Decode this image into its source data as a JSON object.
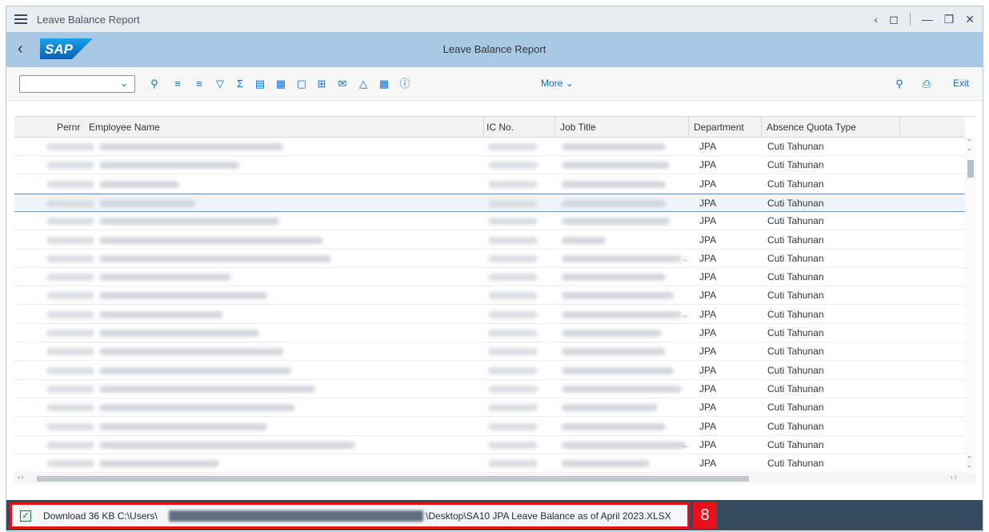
{
  "window": {
    "title": "Leave Balance Report"
  },
  "shell": {
    "title": "Leave Balance Report"
  },
  "toolbar": {
    "more_label": "More",
    "exit_label": "Exit"
  },
  "table": {
    "columns": [
      "Pernr",
      "Employee Name",
      "IC No.",
      "Job Title",
      "Department",
      "Absence Quota Type"
    ],
    "rows": [
      {
        "department": "JPA",
        "quota": "Cuti Tahunan"
      },
      {
        "department": "JPA",
        "quota": "Cuti Tahunan"
      },
      {
        "department": "JPA",
        "quota": "Cuti Tahunan"
      },
      {
        "department": "JPA",
        "quota": "Cuti Tahunan"
      },
      {
        "department": "JPA",
        "quota": "Cuti Tahunan"
      },
      {
        "department": "JPA",
        "quota": "Cuti Tahunan"
      },
      {
        "department": "JPA",
        "quota": "Cuti Tahunan"
      },
      {
        "department": "JPA",
        "quota": "Cuti Tahunan"
      },
      {
        "department": "JPA",
        "quota": "Cuti Tahunan"
      },
      {
        "department": "JPA",
        "quota": "Cuti Tahunan"
      },
      {
        "department": "JPA",
        "quota": "Cuti Tahunan"
      },
      {
        "department": "JPA",
        "quota": "Cuti Tahunan"
      },
      {
        "department": "JPA",
        "quota": "Cuti Tahunan"
      },
      {
        "department": "JPA",
        "quota": "Cuti Tahunan"
      },
      {
        "department": "JPA",
        "quota": "Cuti Tahunan"
      },
      {
        "department": "JPA",
        "quota": "Cuti Tahunan"
      },
      {
        "department": "JPA",
        "quota": "Cuti Tahunan"
      },
      {
        "department": "JPA",
        "quota": "Cuti Tahunan"
      }
    ]
  },
  "download": {
    "prefix": "Download 36 KB C:\\Users\\",
    "suffix": "\\Desktop\\SA10 JPA Leave Balance as of April 2023.XLSX"
  },
  "step_badge": "8",
  "colors": {
    "shell": "#a9c8e3",
    "accent": "#0a6ed1",
    "highlight": "#e8101a",
    "download_bar": "#354a5f"
  }
}
